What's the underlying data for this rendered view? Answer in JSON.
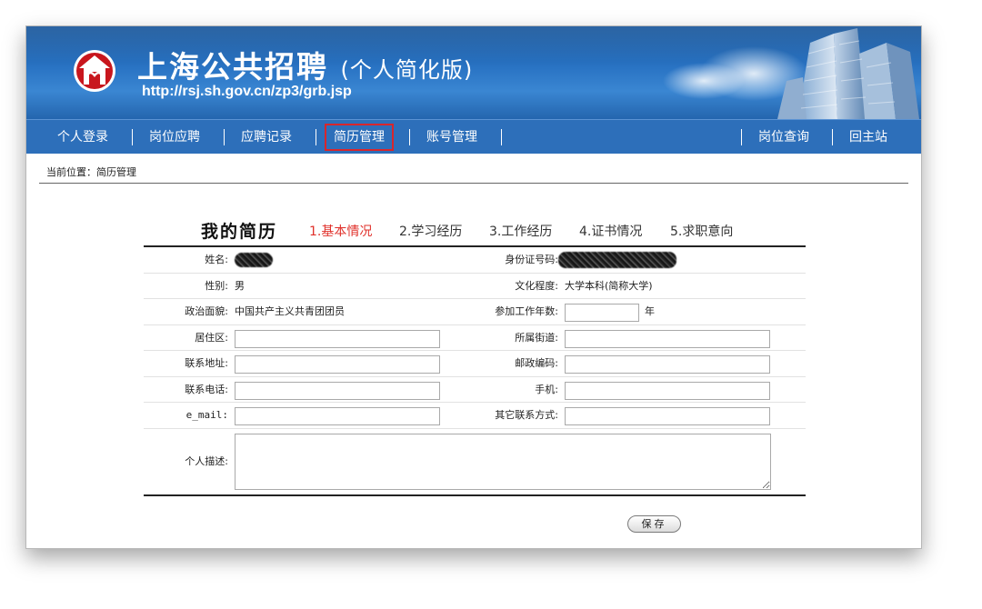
{
  "header": {
    "title": "上海公共招聘",
    "subtitle": "(个人简化版)",
    "url": "http://rsj.sh.gov.cn/zp3/grb.jsp"
  },
  "nav": {
    "left": [
      "个人登录",
      "岗位应聘",
      "应聘记录",
      "简历管理",
      "账号管理"
    ],
    "right": [
      "岗位查询",
      "回主站"
    ],
    "active": "简历管理"
  },
  "breadcrumb": "当前位置：简历管理",
  "resume": {
    "title": "我的简历",
    "steps": [
      "1.基本情况",
      "2.学习经历",
      "3.工作经历",
      "4.证书情况",
      "5.求职意向"
    ],
    "current_step": "1.基本情况"
  },
  "form": {
    "name_label": "姓名:",
    "id_label": "身份证号码:",
    "gender_label": "性别:",
    "gender_value": "男",
    "education_label": "文化程度:",
    "education_value": "大学本科(简称大学)",
    "political_label": "政治面貌:",
    "political_value": "中国共产主义共青团团员",
    "work_years_label": "参加工作年数:",
    "year_unit": "年",
    "district_label": "居住区:",
    "street_label": "所属街道:",
    "address_label": "联系地址:",
    "postcode_label": "邮政编码:",
    "phone_label": "联系电话:",
    "mobile_label": "手机:",
    "email_label": "e_mail:",
    "other_contact_label": "其它联系方式:",
    "description_label": "个人描述:"
  },
  "save_label": "保存",
  "colors": {
    "header_blue": "#2a74c4",
    "nav_blue": "#2d6fba",
    "active_outline": "#d8262c",
    "current_step": "#e0302a"
  },
  "icons": {
    "logo": "shanghai-public-recruitment-logo-icon",
    "buildings": "city-skyline-image"
  }
}
